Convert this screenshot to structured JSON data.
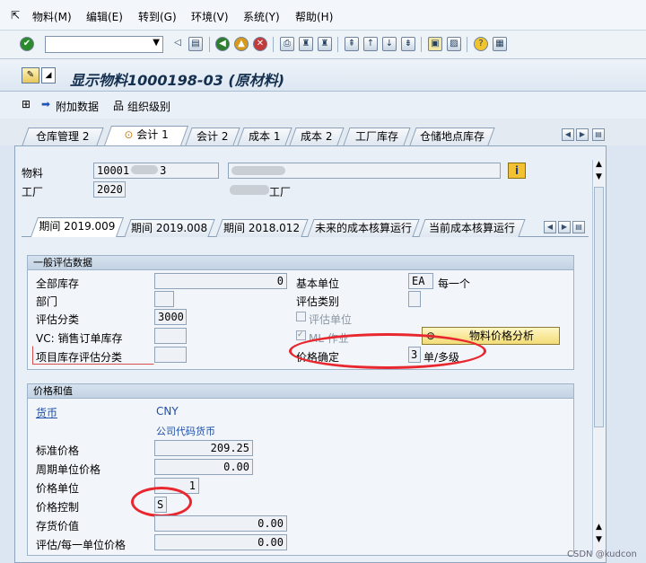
{
  "menubar": {
    "items": [
      "物料(M)",
      "编辑(E)",
      "转到(G)",
      "环境(V)",
      "系统(Y)",
      "帮助(H)"
    ]
  },
  "toolbar": {
    "command_value": ""
  },
  "title": "显示物料1000198-03 (原材料)",
  "app_toolbar": {
    "additional_data": "附加数据",
    "org_levels": "组织级别"
  },
  "outer_tabs": [
    "仓库管理 2",
    "会计 1",
    "会计 2",
    "成本 1",
    "成本 2",
    "工厂库存",
    "仓储地点库存"
  ],
  "header": {
    "material_label": "物料",
    "material_value": "10001",
    "material_value_tail": "3",
    "plant_label": "工厂",
    "plant_value": "2020",
    "plant_desc": "工厂"
  },
  "inner_tabs": [
    "期间 2019.009",
    "期间 2019.008",
    "期间 2018.012",
    "未来的成本核算运行",
    "当前成本核算运行"
  ],
  "general": {
    "title": "一般评估数据",
    "total_stock_label": "全部库存",
    "total_stock_value": "0",
    "base_unit_label": "基本单位",
    "base_unit_value": "EA",
    "base_unit_text": "每一个",
    "division_label": "部门",
    "valuation_category_label": "评估类别",
    "valuation_class_label": "评估分类",
    "valuation_class_value": "3000",
    "valuated_unit_label": "评估单位",
    "vc_label": "VC: 销售订单库存",
    "ml_label": "ML 作业",
    "price_analysis_button": "物料价格分析",
    "project_stock_label": "项目库存评估分类",
    "price_determination_label": "价格确定",
    "price_determination_value": "3",
    "price_determination_text": "单/多级"
  },
  "prices": {
    "title": "价格和值",
    "currency_label": "货币",
    "currency_value": "CNY",
    "company_currency": "公司代码货币",
    "standard_price_label": "标准价格",
    "standard_price_value": "209.25",
    "periodic_price_label": "周期单位价格",
    "periodic_price_value": "0.00",
    "price_unit_label": "价格单位",
    "price_unit_value": "1",
    "price_control_label": "价格控制",
    "price_control_value": "S",
    "inventory_value_label": "存货价值",
    "inventory_value": "0.00",
    "valuation_unit_price_label": "评估/每一单位价格",
    "valuation_unit_price_value": "0.00"
  },
  "watermark": "CSDN @kudcon",
  "colors": {
    "annotation": "#e8272f",
    "info_button": "#f3c232",
    "tab_active": "#ffffff"
  }
}
